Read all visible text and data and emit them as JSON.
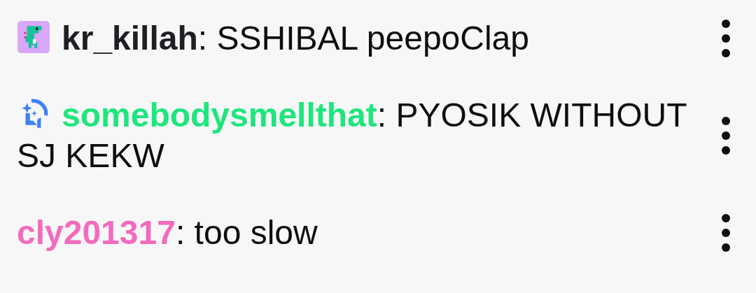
{
  "messages": [
    {
      "kind": "dino-badge",
      "username": "kr_killah",
      "color": "#1f1f23",
      "separator": ":",
      "message": "SSHIBAL peepoClap"
    },
    {
      "kind": "sparkle-badge",
      "username": "somebodysmellthat",
      "color": "#1ee67c",
      "separator": ":",
      "message": "PYOSIK WITHOUT SJ KEKW"
    },
    {
      "kind": "plain",
      "username": "cly201317",
      "color": "#f26bbd",
      "separator": ":",
      "message": "too slow"
    }
  ]
}
